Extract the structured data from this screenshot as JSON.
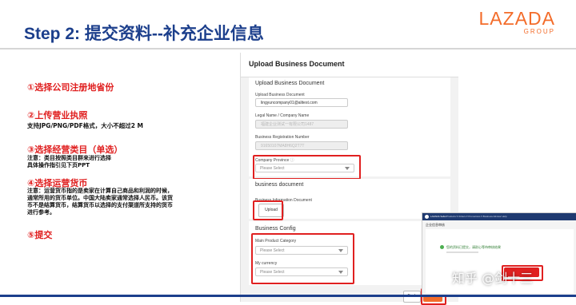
{
  "slide": {
    "title": "Step 2: 提交资料--补充企业信息",
    "logo_main": "LAZADA",
    "logo_sub": "GROUP"
  },
  "steps": [
    {
      "label": "①选择公司注册地省份"
    },
    {
      "label": "②上传营业执照",
      "note": "支持JPG/PNG/PDF格式，大小不超过2 M"
    },
    {
      "label": "③选择经营类目（单选）",
      "note_lines": [
        "注意：类目按照类目群来进行选择",
        "具体操作指引见下页PPT"
      ]
    },
    {
      "label": "④选择运营货币",
      "note_lines": [
        "注意：运营货币指的是卖家在计算自己商品和利润的时候，",
        "通常所用的货币单位。中国大陆卖家通常选择人民币。该货",
        "币不是结算货币，结算货币以选择的支付渠道所支持的货币",
        "进行参考。"
      ]
    },
    {
      "label": "⑤提交"
    }
  ],
  "form": {
    "header_title": "Upload Business Document",
    "section1_title": "Upload Business Document",
    "email_label": "Upload Business Document",
    "email_value": "lingyuncompany01@alitest.com",
    "legal_name_label": "Legal Name / Company Name",
    "legal_name_value": "福建企业测试一有限公司1487",
    "reg_number_label": "Business Registration Number",
    "reg_number_value": "91650107MA8H6Q2T7T",
    "province_label": "Company Province",
    "province_placeholder": "Please Select",
    "section2_title": "business document",
    "biz_info_label": "Business Information Document",
    "upload_button": "Upload",
    "section3_title": "Business Config",
    "category_label": "Main Product Category",
    "category_placeholder": "Please Select",
    "currency_label": "My currency",
    "currency_placeholder": "Please Select",
    "back_button": "Back",
    "submit_button": "Submit"
  },
  "inset": {
    "brand": "LAZADA Seller",
    "menu": "Products ▾  Orders ▾  Promotions ▾  Business Advisor  Help",
    "page_title": "企业信息审核",
    "message": "您的资料已提交，请耐心等待审核结果",
    "button_color": "#e02020"
  },
  "watermark": "知乎 @剑十三",
  "colors": {
    "title": "#1c3f8c",
    "step_red": "#e02020",
    "brand_orange": "#f36c2a",
    "highlight": "#e02020"
  }
}
